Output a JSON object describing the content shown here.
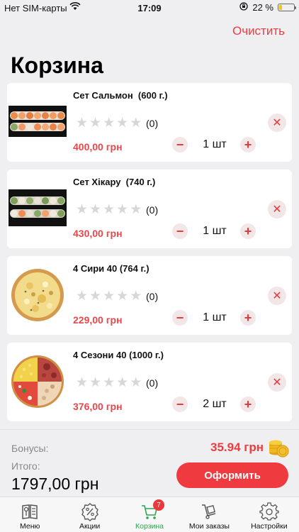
{
  "status_bar": {
    "carrier": "Нет SIM-карты",
    "time": "17:09",
    "battery": "22 %",
    "battery_level": 0.22
  },
  "header": {
    "clear_label": "Очистить",
    "title": "Корзина"
  },
  "cart": {
    "items": [
      {
        "name": "Сет Сальмон  (600 г.)",
        "rating_count": "(0)",
        "rating_stars": 0,
        "price": "400,00 грн",
        "qty": "1 шт",
        "image": "sushi-set"
      },
      {
        "name": "Сет Хікару  (740 г.)",
        "rating_count": "(0)",
        "rating_stars": 0,
        "price": "430,00 грн",
        "qty": "1 шт",
        "image": "sushi-set"
      },
      {
        "name": "4 Сири 40 (764 г.)",
        "rating_count": "(0)",
        "rating_stars": 0,
        "price": "229,00 грн",
        "qty": "1 шт",
        "image": "cheese-pizza"
      },
      {
        "name": "4 Сезони 40 (1000 г.)",
        "rating_count": "(0)",
        "rating_stars": 0,
        "price": "376,00 грн",
        "qty": "2 шт",
        "image": "four-seasons-pizza"
      }
    ],
    "minus_symbol": "−",
    "plus_symbol": "+",
    "remove_symbol": "✕"
  },
  "summary": {
    "bonus_label": "Бонусы:",
    "bonus_value": "35.94 грн",
    "total_label": "Итого:",
    "total_value": "1797,00 грн",
    "checkout_label": "Оформить"
  },
  "tabbar": {
    "tabs": [
      {
        "label": "Меню",
        "icon": "menu-book-icon"
      },
      {
        "label": "Акции",
        "icon": "discount-badge-icon"
      },
      {
        "label": "Корзина",
        "icon": "cart-icon",
        "badge": "7",
        "active": true
      },
      {
        "label": "Мои заказы",
        "icon": "orders-dolly-icon"
      },
      {
        "label": "Настройки",
        "icon": "gear-icon"
      }
    ]
  },
  "colors": {
    "accent_red": "#ef3b3f",
    "price_red": "#e8474b",
    "active_green": "#2fa34f",
    "background": "#efeff1"
  }
}
